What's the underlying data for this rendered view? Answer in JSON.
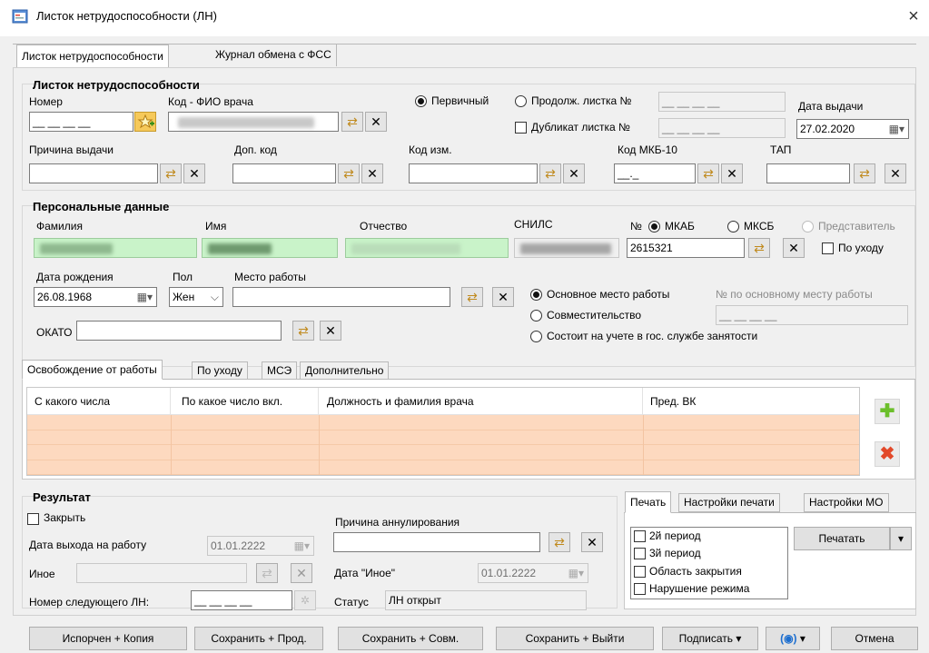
{
  "window": {
    "title": "Листок нетрудоспособности (ЛН)",
    "close": "×"
  },
  "tabs": [
    "Листок нетрудоспособности",
    "Журнал обмена с ФСС"
  ],
  "sheet": {
    "header": "Листок нетрудоспособности",
    "number_label": "Номер",
    "number_value": "__ __ __ __",
    "doctor_label": "Код - ФИО врача",
    "primary_label": "Первичный",
    "continuation_label": "Продолж. листка №",
    "continuation_value": "__ __ __ __",
    "duplicate_label": "Дубликат листка №",
    "duplicate_value": "__ __ __ __",
    "issue_date_label": "Дата выдачи",
    "issue_date_value": "27.02.2020",
    "reason_label": "Причина выдачи",
    "extra_code_label": "Доп. код",
    "change_code_label": "Код изм.",
    "mkb_label": "Код МКБ-10",
    "mkb_value": "__._",
    "tap_label": "ТАП"
  },
  "personal": {
    "header": "Персональные данные",
    "surname_label": "Фамилия",
    "name_label": "Имя",
    "patronymic_label": "Отчество",
    "snils_label": "СНИЛС",
    "no_label": "№",
    "mkab_label": "МКАБ",
    "mksb_label": "МКСБ",
    "representative_label": "Представитель",
    "card_value": "2615321",
    "care_label": "По уходу",
    "birth_label": "Дата рождения",
    "birth_value": "26.08.1968",
    "sex_label": "Пол",
    "sex_value": "Жен",
    "work_label": "Место работы",
    "main_job_label": "Основное место работы",
    "main_job_number_label": "№ по основному месту работы",
    "main_job_number_value": "__ __ __ __",
    "combined_label": "Совместительство",
    "registered_label": "Состоит на учете в гос. службе занятости",
    "okato_label": "ОКАТО"
  },
  "release_tabs": [
    "Освобождение от работы",
    "По уходу",
    "МСЭ",
    "Дополнительно"
  ],
  "release_grid": {
    "columns": [
      "С какого числа",
      "По какое число вкл.",
      "Должность и фамилия врача",
      "Пред. ВК"
    ],
    "rows": [
      [
        "",
        "",
        "",
        ""
      ],
      [
        "",
        "",
        "",
        ""
      ],
      [
        "",
        "",
        "",
        ""
      ],
      [
        "",
        "",
        "",
        ""
      ]
    ]
  },
  "result": {
    "header": "Результат",
    "close_label": "Закрыть",
    "return_date_label": "Дата выхода на работу",
    "return_date_value": "01.01.2222",
    "other_label": "Иное",
    "next_ln_label": "Номер следующего ЛН:",
    "next_ln_value": "__ __ __ __",
    "annul_label": "Причина аннулирования",
    "other_date_label": "Дата \"Иное\"",
    "other_date_value": "01.01.2222",
    "status_label": "Статус",
    "status_value": "ЛН открыт"
  },
  "print_tabs": [
    "Печать",
    "Настройки печати",
    "Настройки МО"
  ],
  "print_options": [
    "2й период",
    "3й период",
    "Область закрытия",
    "Нарушение режима"
  ],
  "print_button": "Печатать",
  "footer": {
    "spoiled_copy": "Испорчен + Копия",
    "save_prod": "Сохранить + Прод.",
    "save_combined": "Сохранить + Совм.",
    "save_exit": "Сохранить + Выйти",
    "sign": "Подписать",
    "cancel": "Отмена"
  },
  "colors": {
    "grid_row": "#fdd9bf",
    "green_field": "#c9f3c9",
    "add_icon": "#6cbf2c",
    "delete_icon": "#e2492a"
  }
}
